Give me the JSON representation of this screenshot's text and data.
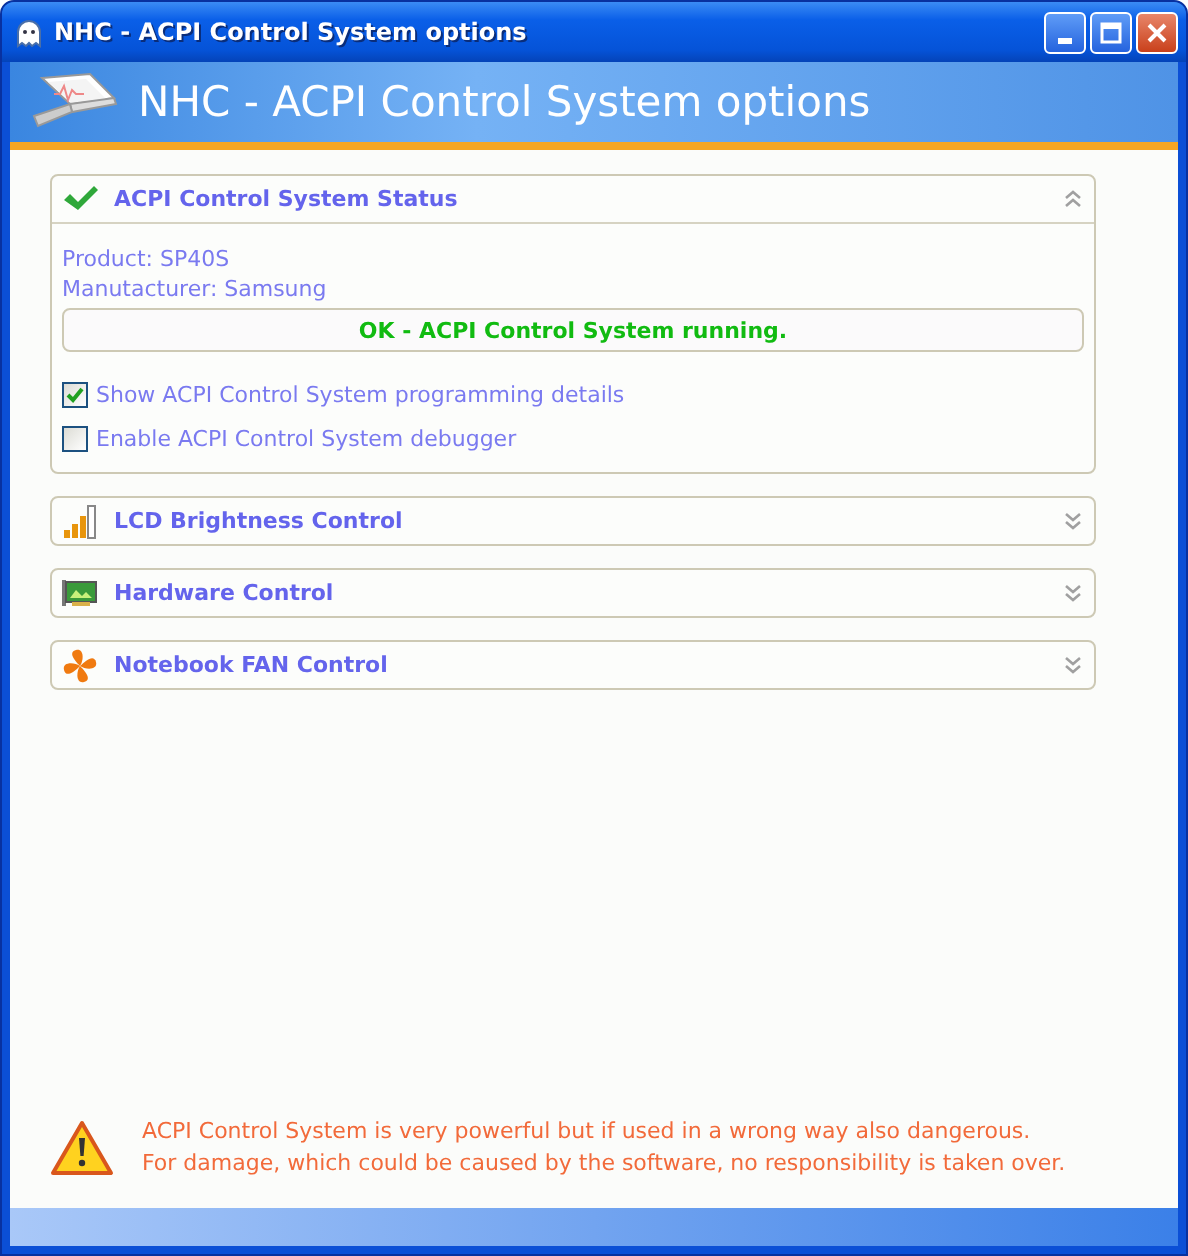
{
  "window": {
    "title": "NHC - ACPI Control System options"
  },
  "header": {
    "title": "NHC - ACPI Control System options"
  },
  "sections": [
    {
      "kind": "status",
      "title": "ACPI Control System Status",
      "expanded": true,
      "details": [
        "Product: SP40S",
        "Manutacturer: Samsung"
      ],
      "status": "OK - ACPI Control System running.",
      "options": [
        {
          "label": "Show ACPI Control System programming details",
          "checked": true
        },
        {
          "label": "Enable ACPI Control System debugger",
          "checked": false
        }
      ]
    },
    {
      "kind": "brightness",
      "title": "LCD Brightness Control",
      "expanded": false
    },
    {
      "kind": "hardware",
      "title": "Hardware Control",
      "expanded": false
    },
    {
      "kind": "fan",
      "title": "Notebook FAN Control",
      "expanded": false
    }
  ],
  "warning": [
    "ACPI Control System is very powerful but if used in a wrong way also dangerous.",
    "For damage, which could be caused by the software, no responsibility is taken over."
  ]
}
